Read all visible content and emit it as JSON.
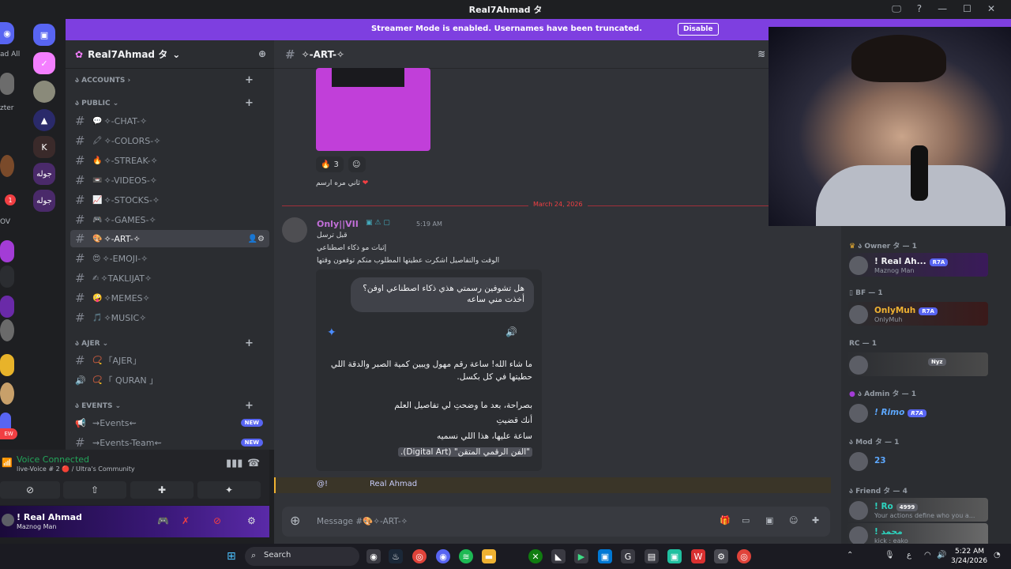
{
  "window": {
    "title": "Real7Ahmad タ",
    "controls": [
      "🖵",
      "?",
      "—",
      "☐",
      "✕"
    ]
  },
  "streamer_banner": {
    "text": "Streamer Mode is enabled. Usernames have been truncated.",
    "button": "Disable"
  },
  "server_rail": {
    "left_labels": [
      "ad All",
      "zter",
      "OV"
    ],
    "folder_labels": [
      "جوله",
      "جوله"
    ],
    "badge_count": "1"
  },
  "sidebar": {
    "server_name": "Real7Ahmad タ",
    "categories": {
      "accounts": "ACCOUNTS",
      "public": "PUBLIC",
      "ajer": "AJER",
      "events": "EVENTS"
    },
    "channels": [
      {
        "glyph": "💬",
        "name": "✧-CHAT-✧"
      },
      {
        "glyph": "🖍",
        "name": "✧-COLORS-✧"
      },
      {
        "glyph": "🔥",
        "name": "✧-STREAK-✧"
      },
      {
        "glyph": "📼",
        "name": "✧-VIDEOS-✧"
      },
      {
        "glyph": "📈",
        "name": "✧-STOCKS-✧"
      },
      {
        "glyph": "🎮",
        "name": "✧-GAMES-✧"
      },
      {
        "glyph": "🎨",
        "name": "✧-ART-✧"
      },
      {
        "glyph": "😍",
        "name": "✧-EMOJI-✧"
      },
      {
        "glyph": "✍",
        "name": "✧TAKLIJAT✧"
      },
      {
        "glyph": "🤪",
        "name": "✧MEMES✧"
      },
      {
        "glyph": "🎵",
        "name": "✧MUSIC✧"
      }
    ],
    "ajer_channels": [
      {
        "glyph": "📿",
        "name": "「AJER」"
      },
      {
        "glyph": "📿",
        "name": "「 QURAN 」"
      }
    ],
    "event_channels": [
      {
        "name": "⇝Events⇜",
        "badge": "NEW"
      },
      {
        "name": "⇝Events-Team⇜",
        "badge": "NEW"
      }
    ]
  },
  "voice": {
    "status": "Voice Connected",
    "channel": "live-Voice # 2 🔴 / Ultra's Community"
  },
  "user_panel": {
    "name": "! Real Ahmad",
    "status": "Maznog Man"
  },
  "chat": {
    "channel_name": "✧-ART-✧",
    "reaction_count": "3",
    "above_line": "ثاني مره ارسم",
    "date_divider": "March 24, 2026",
    "author": "Only||VII",
    "time": "5:19 AM",
    "lines": [
      "قبل ترسل",
      "إثبات مو ذكاء اصطناعي",
      "الوقت والتفاصيل اشكرت عطيتها المطلوب منكم توقعون وقتها"
    ],
    "bubble": "هل تشوفين رسمتي هذي ذكاء اصطناعي اوفن؟ أخذت مني      ساعه",
    "reply_p1": "ما شاء الله!      ساعة رقم مهول ويبين كمية الصبر والدقة اللي حطيتها في كل بكسل.",
    "reply_p2a": "بصراحة، بعد ما وضحتِ لي تفاصيل العلم",
    "reply_p2b": "أنك قضيتِ",
    "reply_p2c": "ساعة عليها،             هذا اللي نسميه",
    "reply_p2d": "\"الفن الرقمي المتقن\" (Digital Art).",
    "mention_at": "@!",
    "mention_name": "Real Ahmad",
    "input_placeholder": "Message #🎨✧-ART-✧"
  },
  "members": {
    "groups": [
      {
        "label": "ა Owner タ — 1"
      },
      {
        "label": "BF — 1"
      },
      {
        "label": "RC — 1"
      },
      {
        "label": "ა Admin タ — 1"
      },
      {
        "label": "ა Mod タ — 1"
      },
      {
        "label": "ა Friend タ — 4"
      }
    ],
    "items": [
      {
        "name": "! Real Ah...",
        "sub": "Maznog Man",
        "badge": "R7A",
        "color": "#f2f3f5"
      },
      {
        "name": "OnlyMuh",
        "sub": "OnlyMuh",
        "badge": "R7A",
        "color": "#f0b232"
      },
      {
        "name": "Nyz",
        "sub": "",
        "badge": "",
        "color": "#f23f43"
      },
      {
        "name": "! Rimo",
        "sub": "",
        "badge": "R7A",
        "color": "#5da8ff"
      },
      {
        "name": "23",
        "sub": "",
        "badge": "",
        "color": "#5da8ff"
      },
      {
        "name": "! Ro",
        "sub": "Your actions define who you a...",
        "badge": "4999",
        "color": "#2dd4bf"
      },
      {
        "name": "! محمد",
        "sub": "kick : eako",
        "badge": "",
        "color": "#2dd4bf"
      }
    ]
  },
  "taskbar": {
    "search": "Search",
    "time": "5:22 AM",
    "date": "3/24/2026",
    "lang": "ع"
  },
  "colors": {
    "banner": "#7e3fe0",
    "accent": "#5865f2",
    "online": "#23a55a",
    "mention": "#f0b232"
  }
}
